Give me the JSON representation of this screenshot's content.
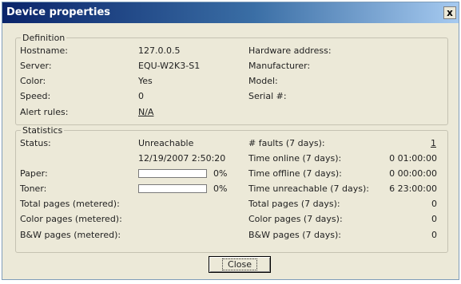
{
  "window": {
    "title": "Device properties",
    "close_glyph": "x"
  },
  "definition": {
    "legend": "Definition",
    "left": [
      {
        "label": "Hostname:",
        "value": "127.0.0.5"
      },
      {
        "label": "Server:",
        "value": "EQU-W2K3-S1"
      },
      {
        "label": "Color:",
        "value": "Yes"
      },
      {
        "label": "Speed:",
        "value": "0"
      },
      {
        "label": "Alert rules:",
        "value": "N/A"
      }
    ],
    "right": [
      {
        "label": "Hardware address:"
      },
      {
        "label": "Manufacturer:"
      },
      {
        "label": "Model:"
      },
      {
        "label": "Serial #:"
      }
    ]
  },
  "statistics": {
    "legend": "Statistics",
    "status": {
      "label": "Status:",
      "value": "Unreachable",
      "timestamp": "12/19/2007 2:50:20"
    },
    "paper": {
      "label": "Paper:",
      "percent_text": "0%",
      "level": 0
    },
    "toner": {
      "label": "Toner:",
      "percent_text": "0%",
      "level": 0
    },
    "metered": [
      {
        "label": "Total pages (metered):"
      },
      {
        "label": "Color pages (metered):"
      },
      {
        "label": "B&W pages (metered):"
      }
    ],
    "right": [
      {
        "label": "# faults (7 days):",
        "value": "1"
      },
      {
        "label": "Time online (7 days):",
        "value": "0 01:00:00"
      },
      {
        "label": "Time offline (7 days):",
        "value": "0 00:00:00"
      },
      {
        "label": "Time unreachable (7 days):",
        "value": "6 23:00:00"
      },
      {
        "label": "Total pages (7 days):",
        "value": "0"
      },
      {
        "label": "Color pages (7 days):",
        "value": "0"
      },
      {
        "label": "B&W pages (7 days):",
        "value": "0"
      }
    ]
  },
  "buttons": {
    "close": "Close"
  }
}
